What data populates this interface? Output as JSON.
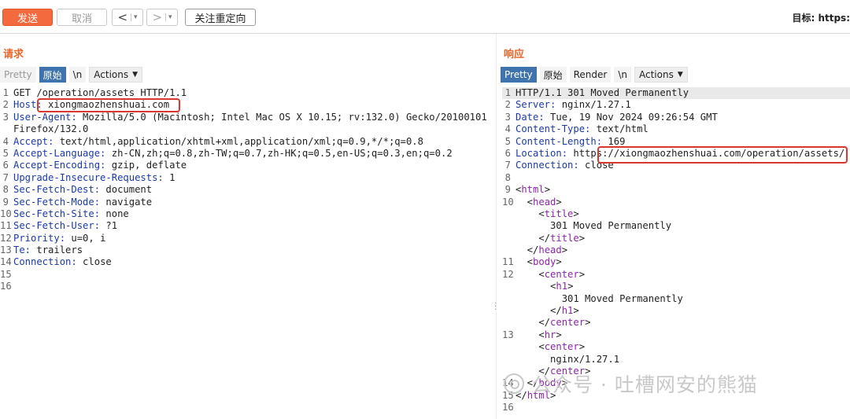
{
  "toolbar": {
    "send": "发送",
    "cancel": "取消",
    "back": "<",
    "forward": ">",
    "dropdown": "▾",
    "follow": "关注重定向",
    "target": "目标: https:"
  },
  "request": {
    "title": "请求",
    "tabs": [
      "Pretty",
      "原始",
      "\\n",
      "Actions"
    ],
    "lines": [
      {
        "n": "1",
        "k": "",
        "v": "GET /operation/assets HTTP/1.1"
      },
      {
        "n": "2",
        "k": "Host:",
        "v": " xiongmaozhenshuai.com"
      },
      {
        "n": "3",
        "k": "User-Agent:",
        "v": " Mozilla/5.0 (Macintosh; Intel Mac OS X 10.15; rv:132.0) Gecko/20100101"
      },
      {
        "n": "",
        "k": "",
        "v": "Firefox/132.0"
      },
      {
        "n": "4",
        "k": "Accept:",
        "v": " text/html,application/xhtml+xml,application/xml;q=0.9,*/*;q=0.8"
      },
      {
        "n": "5",
        "k": "Accept-Language:",
        "v": " zh-CN,zh;q=0.8,zh-TW;q=0.7,zh-HK;q=0.5,en-US;q=0.3,en;q=0.2"
      },
      {
        "n": "6",
        "k": "Accept-Encoding:",
        "v": " gzip, deflate"
      },
      {
        "n": "7",
        "k": "Upgrade-Insecure-Requests:",
        "v": " 1"
      },
      {
        "n": "8",
        "k": "Sec-Fetch-Dest:",
        "v": " document"
      },
      {
        "n": "9",
        "k": "Sec-Fetch-Mode:",
        "v": " navigate"
      },
      {
        "n": "10",
        "k": "Sec-Fetch-Site:",
        "v": " none"
      },
      {
        "n": "11",
        "k": "Sec-Fetch-User:",
        "v": " ?1"
      },
      {
        "n": "12",
        "k": "Priority:",
        "v": " u=0, i"
      },
      {
        "n": "13",
        "k": "Te:",
        "v": " trailers"
      },
      {
        "n": "14",
        "k": "Connection:",
        "v": " close"
      },
      {
        "n": "15",
        "k": "",
        "v": ""
      },
      {
        "n": "16",
        "k": "",
        "v": ""
      }
    ]
  },
  "response": {
    "title": "响应",
    "tabs": [
      "Pretty",
      "原始",
      "Render",
      "\\n",
      "Actions"
    ],
    "lines": [
      {
        "n": "1",
        "parts": [
          [
            "plain",
            "HTTP/1.1 301 Moved Permanently"
          ]
        ],
        "hl": true
      },
      {
        "n": "2",
        "parts": [
          [
            "k",
            "Server:"
          ],
          [
            "plain",
            " nginx/1.27.1"
          ]
        ]
      },
      {
        "n": "3",
        "parts": [
          [
            "k",
            "Date:"
          ],
          [
            "plain",
            " Tue, 19 Nov 2024 09:26:54 GMT"
          ]
        ]
      },
      {
        "n": "4",
        "parts": [
          [
            "k",
            "Content-Type:"
          ],
          [
            "plain",
            " text/html"
          ]
        ]
      },
      {
        "n": "5",
        "parts": [
          [
            "k",
            "Content-Length:"
          ],
          [
            "plain",
            " 169"
          ]
        ]
      },
      {
        "n": "6",
        "parts": [
          [
            "k",
            "Location:"
          ],
          [
            "plain",
            " https://xiongmaozhenshuai.com/operation/assets/"
          ]
        ]
      },
      {
        "n": "7",
        "parts": [
          [
            "k",
            "Connection:"
          ],
          [
            "plain",
            " close"
          ]
        ]
      },
      {
        "n": "8",
        "parts": []
      },
      {
        "n": "9",
        "parts": [
          [
            "plain",
            "<"
          ],
          [
            "tag",
            "html"
          ],
          [
            "plain",
            ">"
          ]
        ]
      },
      {
        "n": "10",
        "parts": [
          [
            "plain",
            "  <"
          ],
          [
            "tag",
            "head"
          ],
          [
            "plain",
            ">"
          ]
        ]
      },
      {
        "n": "",
        "parts": [
          [
            "plain",
            "    <"
          ],
          [
            "tag",
            "title"
          ],
          [
            "plain",
            ">"
          ]
        ]
      },
      {
        "n": "",
        "parts": [
          [
            "plain",
            "      301 Moved Permanently"
          ]
        ]
      },
      {
        "n": "",
        "parts": [
          [
            "plain",
            "    </"
          ],
          [
            "tag",
            "title"
          ],
          [
            "plain",
            ">"
          ]
        ]
      },
      {
        "n": "",
        "parts": [
          [
            "plain",
            "  </"
          ],
          [
            "tag",
            "head"
          ],
          [
            "plain",
            ">"
          ]
        ]
      },
      {
        "n": "11",
        "parts": [
          [
            "plain",
            "  <"
          ],
          [
            "tag",
            "body"
          ],
          [
            "plain",
            ">"
          ]
        ]
      },
      {
        "n": "12",
        "parts": [
          [
            "plain",
            "    <"
          ],
          [
            "tag",
            "center"
          ],
          [
            "plain",
            ">"
          ]
        ]
      },
      {
        "n": "",
        "parts": [
          [
            "plain",
            "      <"
          ],
          [
            "tag",
            "h1"
          ],
          [
            "plain",
            ">"
          ]
        ]
      },
      {
        "n": "",
        "parts": [
          [
            "plain",
            "        301 Moved Permanently"
          ]
        ]
      },
      {
        "n": "",
        "parts": [
          [
            "plain",
            "      </"
          ],
          [
            "tag",
            "h1"
          ],
          [
            "plain",
            ">"
          ]
        ]
      },
      {
        "n": "",
        "parts": [
          [
            "plain",
            "    </"
          ],
          [
            "tag",
            "center"
          ],
          [
            "plain",
            ">"
          ]
        ]
      },
      {
        "n": "13",
        "parts": [
          [
            "plain",
            "    <"
          ],
          [
            "tag",
            "hr"
          ],
          [
            "plain",
            ">"
          ]
        ]
      },
      {
        "n": "",
        "parts": [
          [
            "plain",
            "    <"
          ],
          [
            "tag",
            "center"
          ],
          [
            "plain",
            ">"
          ]
        ]
      },
      {
        "n": "",
        "parts": [
          [
            "plain",
            "      nginx/1.27.1"
          ]
        ]
      },
      {
        "n": "",
        "parts": [
          [
            "plain",
            "    </"
          ],
          [
            "tag",
            "center"
          ],
          [
            "plain",
            ">"
          ]
        ]
      },
      {
        "n": "14",
        "parts": [
          [
            "plain",
            "  </"
          ],
          [
            "tag",
            "body"
          ],
          [
            "plain",
            ">"
          ]
        ]
      },
      {
        "n": "15",
        "parts": [
          [
            "plain",
            "</"
          ],
          [
            "tag",
            "html"
          ],
          [
            "plain",
            ">"
          ]
        ]
      },
      {
        "n": "16",
        "parts": []
      }
    ]
  },
  "watermark": "公众号 · 吐槽网安的熊猫"
}
